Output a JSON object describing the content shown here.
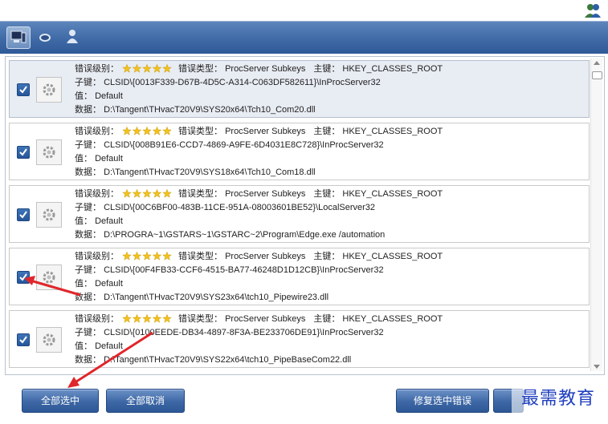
{
  "labels": {
    "level": "错误级别：",
    "type": "错误类型：",
    "key": "主键：",
    "subkey": "子键：",
    "value": "值：",
    "data": "数据："
  },
  "items": [
    {
      "type": "ProcServer Subkeys",
      "key": "HKEY_CLASSES_ROOT",
      "subkey": "CLSID\\{0013F339-D67B-4D5C-A314-C063DF582611}\\InProcServer32",
      "value": "Default",
      "data": "D:\\Tangent\\THvacT20V9\\SYS20x64\\Tch10_Com20.dll",
      "checked": true,
      "selected": true
    },
    {
      "type": "ProcServer Subkeys",
      "key": "HKEY_CLASSES_ROOT",
      "subkey": "CLSID\\{008B91E6-CCD7-4869-A9FE-6D4031E8C728}\\InProcServer32",
      "value": "Default",
      "data": "D:\\Tangent\\THvacT20V9\\SYS18x64\\Tch10_Com18.dll",
      "checked": true,
      "selected": false
    },
    {
      "type": "ProcServer Subkeys",
      "key": "HKEY_CLASSES_ROOT",
      "subkey": "CLSID\\{00C6BF00-483B-11CE-951A-08003601BE52}\\LocalServer32",
      "value": "Default",
      "data": "D:\\PROGRA~1\\GSTARS~1\\GSTARC~2\\Program\\Edge.exe /automation",
      "checked": true,
      "selected": false
    },
    {
      "type": "ProcServer Subkeys",
      "key": "HKEY_CLASSES_ROOT",
      "subkey": "CLSID\\{00F4FB33-CCF6-4515-BA77-46248D1D12CB}\\InProcServer32",
      "value": "Default",
      "data": "D:\\Tangent\\THvacT20V9\\SYS23x64\\tch10_Pipewire23.dll",
      "checked": true,
      "selected": false
    },
    {
      "type": "ProcServer Subkeys",
      "key": "HKEY_CLASSES_ROOT",
      "subkey": "CLSID\\{0100EEDE-DB34-4897-8F3A-BE233706DE91}\\InProcServer32",
      "value": "Default",
      "data": "D:\\Tangent\\THvacT20V9\\SYS22x64\\tch10_PipeBaseCom22.dll",
      "checked": true,
      "selected": false
    }
  ],
  "buttons": {
    "select_all": "全部选中",
    "deselect_all": "全部取消",
    "fix_selected": "修复选中错误"
  },
  "watermark": "最需教育",
  "colors": {
    "toolbar": "#3f6aa6",
    "button": "#3d67a5",
    "star": "#f2c21b",
    "arrow": "#e0262b"
  }
}
